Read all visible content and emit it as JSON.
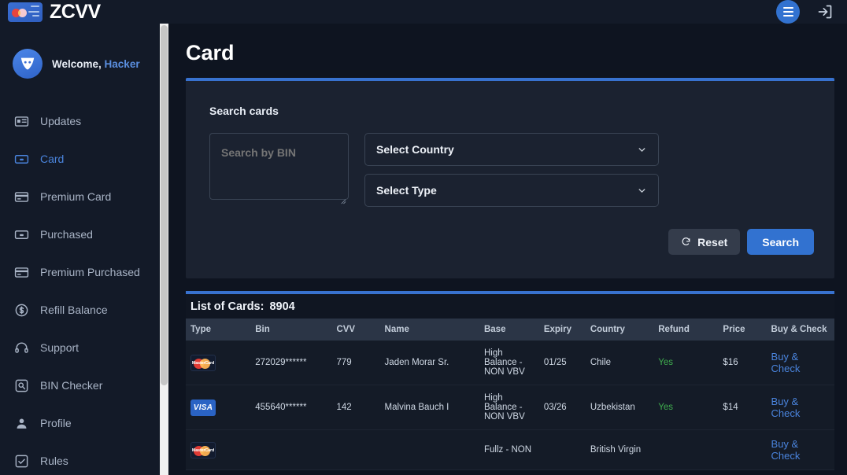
{
  "topbar": {
    "brand_name": "ZCVV",
    "brand_icon": "credit-card-icon",
    "menu_icon": "hamburger-menu-icon",
    "logout_icon": "logout-icon"
  },
  "sidebar": {
    "welcome_prefix": "Welcome,",
    "username": "Hacker",
    "avatar_icon": "mask-avatar-icon",
    "items": [
      {
        "label": "Updates",
        "icon": "news-icon",
        "active": false
      },
      {
        "label": "Card",
        "icon": "card-icon",
        "active": true
      },
      {
        "label": "Premium Card",
        "icon": "credit-card-icon",
        "active": false
      },
      {
        "label": "Purchased",
        "icon": "card-icon",
        "active": false
      },
      {
        "label": "Premium Purchased",
        "icon": "credit-card-icon",
        "active": false
      },
      {
        "label": "Refill Balance",
        "icon": "dollar-coin-icon",
        "active": false
      },
      {
        "label": "Support",
        "icon": "headset-icon",
        "active": false
      },
      {
        "label": "BIN Checker",
        "icon": "search-box-icon",
        "active": false
      },
      {
        "label": "Profile",
        "icon": "user-icon",
        "active": false
      },
      {
        "label": "Rules",
        "icon": "checkbox-icon",
        "active": false
      }
    ]
  },
  "page": {
    "title": "Card"
  },
  "search_panel": {
    "title": "Search cards",
    "bin_placeholder": "Search by BIN",
    "bin_value": "",
    "country_select": "Select Country",
    "type_select": "Select Type",
    "reset_label": "Reset",
    "reset_icon": "refresh-icon",
    "search_label": "Search"
  },
  "table": {
    "list_label": "List of Cards:",
    "list_count": "8904",
    "columns": [
      "Type",
      "Bin",
      "CVV",
      "Name",
      "Base",
      "Expiry",
      "Country",
      "Refund",
      "Price",
      "Buy & Check"
    ],
    "buy_label": "Buy & Check",
    "rows": [
      {
        "type": "mastercard",
        "bin": "272029******",
        "cvv": "779",
        "name": "Jaden Morar Sr.",
        "base": "High Balance - NON VBV",
        "expiry": "01/25",
        "country": "Chile",
        "refund": "Yes",
        "price": "$16"
      },
      {
        "type": "visa",
        "bin": "455640******",
        "cvv": "142",
        "name": "Malvina Bauch I",
        "base": "High Balance - NON VBV",
        "expiry": "03/26",
        "country": "Uzbekistan",
        "refund": "Yes",
        "price": "$14"
      },
      {
        "type": "mastercard",
        "bin": "",
        "cvv": "",
        "name": "",
        "base": "Fullz - NON",
        "expiry": "",
        "country": "British Virgin",
        "refund": "",
        "price": ""
      }
    ]
  },
  "colors": {
    "accent_blue": "#3272d0",
    "link_blue": "#4a84dd",
    "refund_green": "#3fae4e",
    "page_bg": "#0e1420",
    "panel_bg": "#1b2230",
    "sidebar_bg": "#131a28",
    "table_head_bg": "#2b3546"
  }
}
